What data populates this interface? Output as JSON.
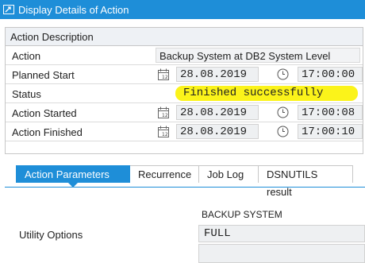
{
  "window": {
    "title": "Display Details of Action"
  },
  "panel": {
    "heading": "Action Description",
    "rows": {
      "action": {
        "label": "Action",
        "value": "Backup System at DB2 System Level"
      },
      "planned_start": {
        "label": "Planned Start",
        "date": "28.08.2019",
        "time": "17:00:00"
      },
      "status": {
        "label": "Status",
        "value": "Finished successfully"
      },
      "action_started": {
        "label": "Action Started",
        "date": "28.08.2019",
        "time": "17:00:08"
      },
      "action_finished": {
        "label": "Action Finished",
        "date": "28.08.2019",
        "time": "17:00:10"
      }
    }
  },
  "tabs": {
    "items": [
      "Action Parameters",
      "Recurrence",
      "Job Log",
      "DSNUTILS result"
    ],
    "active": "Action Parameters"
  },
  "parameters": {
    "section_heading": "BACKUP SYSTEM",
    "utility_options_label": "Utility Options",
    "utility_options_value": "FULL"
  },
  "icons": {
    "title_icon": "display-details-icon",
    "calendar": "calendar-icon",
    "clock": "clock-icon"
  },
  "colors": {
    "accent": "#1e8ed8",
    "highlight": "#fbf31a"
  }
}
